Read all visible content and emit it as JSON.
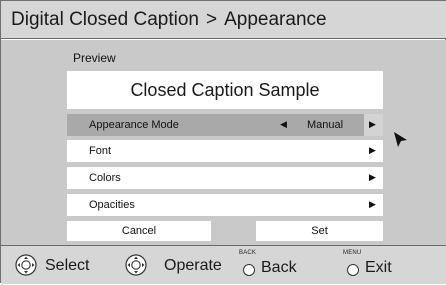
{
  "header": {
    "breadcrumb_root": "Digital Closed Caption",
    "separator": ">",
    "current_page": "Appearance"
  },
  "preview": {
    "label": "Preview",
    "sample_text": "Closed Caption Sample"
  },
  "menu": {
    "items": [
      {
        "label": "Appearance Mode",
        "value": "Manual",
        "selected": true
      },
      {
        "label": "Font"
      },
      {
        "label": "Colors"
      },
      {
        "label": "Opacities"
      }
    ]
  },
  "buttons": {
    "cancel": "Cancel",
    "set": "Set"
  },
  "footer": {
    "select": "Select",
    "operate": "Operate",
    "back_small": "BACK",
    "back": "Back",
    "exit_small": "MENU",
    "exit": "Exit"
  },
  "icons": {
    "arrow_left": "◀",
    "arrow_right": "▶"
  },
  "colors": {
    "panel": "#c9c9c9",
    "bar": "#d6d6d6",
    "selected_row": "#a9a9a9"
  }
}
